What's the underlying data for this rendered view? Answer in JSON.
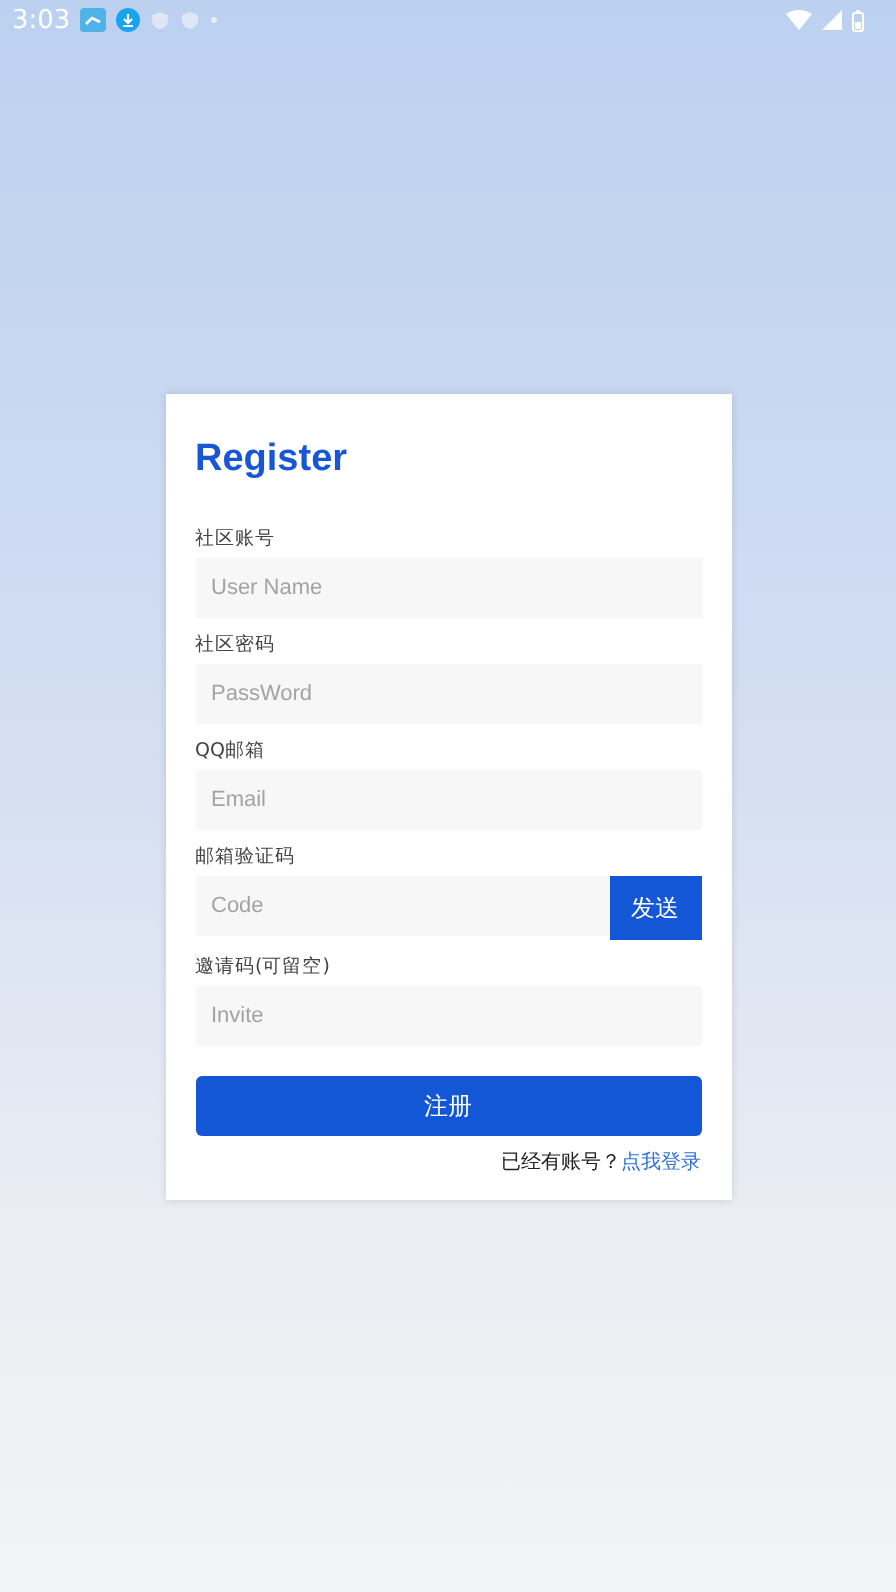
{
  "status_bar": {
    "time": "3:03"
  },
  "form": {
    "title": "Register",
    "fields": [
      {
        "label": "社区账号",
        "placeholder": "User Name"
      },
      {
        "label": "社区密码",
        "placeholder": "PassWord"
      },
      {
        "label": "QQ邮箱",
        "placeholder": "Email"
      },
      {
        "label": "邮箱验证码",
        "placeholder": "Code",
        "button": "发送"
      },
      {
        "label": "邀请码(可留空)",
        "placeholder": "Invite"
      }
    ],
    "submit": "注册",
    "footer": {
      "text": "已经有账号？",
      "link": "点我登录"
    }
  }
}
